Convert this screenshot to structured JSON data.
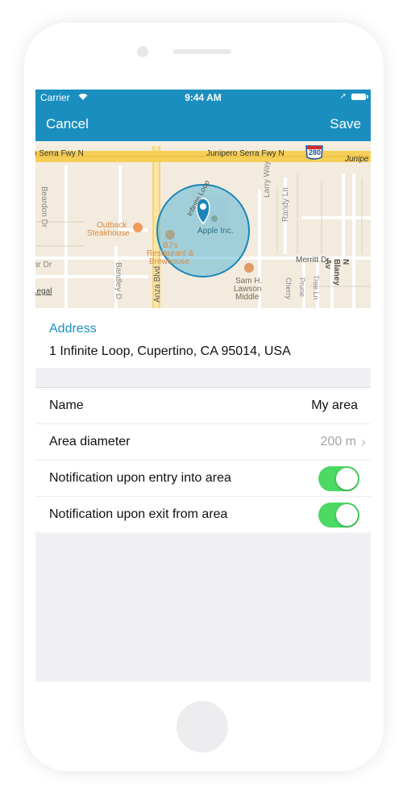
{
  "status_bar": {
    "carrier": "Carrier",
    "time": "9:44 AM"
  },
  "nav": {
    "cancel": "Cancel",
    "save": "Save"
  },
  "map": {
    "labels": {
      "serra_fwy_left": "o Serra Fwy N",
      "junipero_serra_fwy_n": "Junipero Serra Fwy N",
      "junipero_right": "Junipe",
      "route": "280",
      "beardon": "Beardon Dr",
      "outback_1": "Outback",
      "outback_2": "Steakhouse",
      "bjs_1": "BJ's",
      "bjs_2": "Restaurant &",
      "bjs_3": "Brewhouse",
      "infinite_loop": "Infinite Loop",
      "apple": "Apple Inc.",
      "larry_way": "Larry Way",
      "randy_ln": "Randy Ln",
      "merritt": "Merritt Dr",
      "ar_dr": "ar Dr",
      "bandley": "Bandley D",
      "anza": "Anza Blvd",
      "cherry": "Cherry",
      "prune": "Prune",
      "tree": "Tree Ln",
      "blaney": "N Blaney Av",
      "sam_1": "Sam H.",
      "sam_2": "Lawson",
      "sam_3": "Middle",
      "legal": "Legal"
    },
    "colors": {
      "water_circle": "#5fb8d6",
      "pin": "#1b85b8",
      "freeway": "#f6cf58"
    }
  },
  "address": {
    "label": "Address",
    "value": "1 Infinite Loop, Cupertino, CA 95014, USA"
  },
  "settings": {
    "name": {
      "label": "Name",
      "value": "My area"
    },
    "diameter": {
      "label": "Area diameter",
      "value": "200 m",
      "chevron": "›"
    },
    "entry": {
      "label": "Notification upon entry into area",
      "on": true
    },
    "exit": {
      "label": "Notification upon exit from area",
      "on": true
    }
  },
  "colors": {
    "accent": "#1a8fbf",
    "toggle_on": "#4cd964"
  }
}
